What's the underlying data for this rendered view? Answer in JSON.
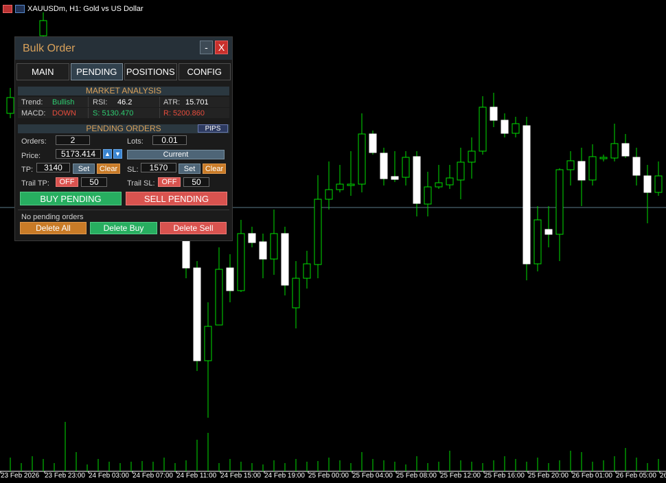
{
  "window": {
    "title": "XAUUSDm, H1:  Gold vs US Dollar"
  },
  "panel": {
    "title": "Bulk Order",
    "minimize_label": "-",
    "close_label": "X",
    "tabs": [
      {
        "label": "MAIN"
      },
      {
        "label": "PENDING",
        "active": true
      },
      {
        "label": "POSITIONS"
      },
      {
        "label": "CONFIG"
      }
    ],
    "market": {
      "header": "MARKET ANALYSIS",
      "trend_label": "Trend:",
      "trend_value": "Bullish",
      "rsi_label": "RSI:",
      "rsi_value": "46.2",
      "atr_label": "ATR:",
      "atr_value": "15.701",
      "macd_label": "MACD:",
      "macd_value": "DOWN",
      "support_value": "S: 5130.470",
      "resistance_value": "R: 5200.860"
    },
    "pending": {
      "header": "PENDING ORDERS",
      "pips_label": "PIPS",
      "orders_label": "Orders:",
      "orders_value": "2",
      "lots_label": "Lots:",
      "lots_value": "0.01",
      "price_label": "Price:",
      "price_value": "5173.414",
      "current_label": "Current",
      "tp_label": "TP:",
      "tp_value": "3140",
      "sl_label": "SL:",
      "sl_value": "1570",
      "set_label": "Set",
      "clear_label": "Clear",
      "trail_tp_label": "Trail TP:",
      "trail_tp_state": "OFF",
      "trail_tp_value": "50",
      "trail_sl_label": "Trail SL:",
      "trail_sl_state": "OFF",
      "trail_sl_value": "50",
      "buy_label": "BUY PENDING",
      "sell_label": "SELL PENDING",
      "status_text": "No pending orders",
      "delete_all_label": "Delete All",
      "delete_buy_label": "Delete Buy",
      "delete_sell_label": "Delete Sell"
    }
  },
  "colors": {
    "bull": "#00e000",
    "bear": "#ffffff",
    "volume": "#00e000",
    "grid_line": "#5a7a8a"
  },
  "chart_data": {
    "type": "candlestick",
    "symbol": "XAUUSDm",
    "timeframe": "H1",
    "x_labels": [
      "23 Feb 2026",
      "23 Feb 23:00",
      "24 Feb 03:00",
      "24 Feb 07:00",
      "24 Feb 11:00",
      "24 Feb 15:00",
      "24 Feb 19:00",
      "25 Feb 00:00",
      "25 Feb 04:00",
      "25 Feb 08:00",
      "25 Feb 12:00",
      "25 Feb 16:00",
      "25 Feb 20:00",
      "26 Feb 01:00",
      "26 Feb 05:00",
      "26"
    ]
  }
}
